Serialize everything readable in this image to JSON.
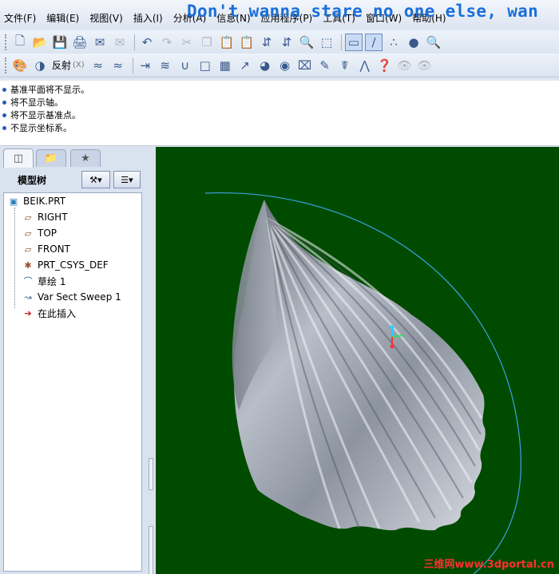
{
  "menubar": {
    "items": [
      "文件(F)",
      "编辑(E)",
      "视图(V)",
      "插入(I)",
      "分析(A)",
      "信息(N)",
      "应用程序(P)",
      "工具(T)",
      "窗口(W)",
      "帮助(H)"
    ],
    "overlay_text": "Don't wanna stare no one else, wan"
  },
  "toolbar2": {
    "reflect_label": "反射",
    "reflect_shortcut": "(X)"
  },
  "messages": [
    "基准平面将不显示。",
    "将不显示轴。",
    "将不显示基准点。",
    "不显示坐标系。"
  ],
  "model_tree": {
    "title": "模型树",
    "items": [
      {
        "label": "BEIK.PRT",
        "icon": "part-icon"
      },
      {
        "label": "RIGHT",
        "icon": "datum-plane-icon"
      },
      {
        "label": "TOP",
        "icon": "datum-plane-icon"
      },
      {
        "label": "FRONT",
        "icon": "datum-plane-icon"
      },
      {
        "label": "PRT_CSYS_DEF",
        "icon": "csys-icon"
      },
      {
        "label": "草绘 1",
        "icon": "sketch-icon"
      },
      {
        "label": "Var Sect Sweep 1",
        "icon": "sweep-icon"
      },
      {
        "label": "在此插入",
        "icon": "insert-here-icon"
      }
    ]
  },
  "viewport": {
    "watermark": "三维网www.3dportal.cn"
  },
  "colors": {
    "viewport_bg": "#004b00",
    "overlay_text": "#1a6fd8",
    "watermark": "#ff3030"
  }
}
